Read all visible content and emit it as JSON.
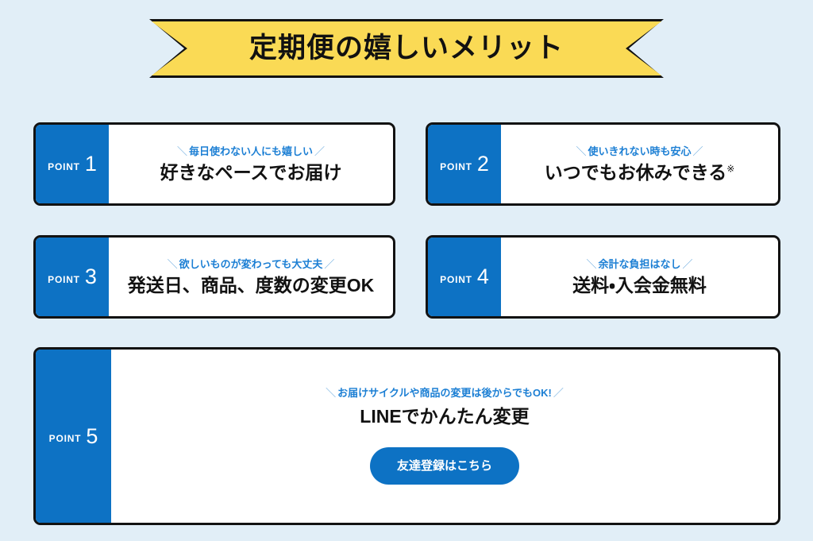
{
  "theme": {
    "background": "#e1eef7",
    "accent_blue": "#0d72c4",
    "subtitle_blue": "#1c7fd4",
    "banner_yellow": "#fada55",
    "outline_black": "#121212"
  },
  "banner": {
    "title": "定期便の嬉しいメリット"
  },
  "cards": [
    {
      "point_label": "POINT",
      "number": "1",
      "slash_left": "＼",
      "slash_right": "／",
      "subtitle": "毎日使わない人にも嬉しい",
      "title": "好きなペースでお届け",
      "note_mark": ""
    },
    {
      "point_label": "POINT",
      "number": "2",
      "slash_left": "＼",
      "slash_right": "／",
      "subtitle": "使いきれない時も安心",
      "title": "いつでもお休みできる",
      "note_mark": "※"
    },
    {
      "point_label": "POINT",
      "number": "3",
      "slash_left": "＼",
      "slash_right": "／",
      "subtitle": "欲しいものが変わっても大丈夫",
      "title": "発送日、商品、度数の変更OK",
      "note_mark": ""
    },
    {
      "point_label": "POINT",
      "number": "4",
      "slash_left": "＼",
      "slash_right": "／",
      "subtitle": "余計な負担はなし",
      "title": "送料・入会金無料",
      "note_mark": ""
    },
    {
      "point_label": "POINT",
      "number": "5",
      "slash_left": "＼",
      "slash_right": "／",
      "subtitle": "お届けサイクルや商品の変更は後からでもOK!",
      "title": "LINEでかんたん変更",
      "note_mark": "",
      "button_label": "友達登録はこちら"
    }
  ]
}
